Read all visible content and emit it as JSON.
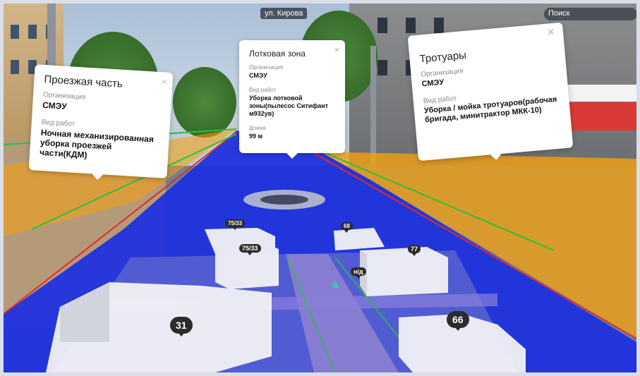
{
  "map": {
    "street_label": "ул. Кирова",
    "search_placeholder": "Поиск"
  },
  "cards": [
    {
      "title": "Проезжая часть",
      "org_label": "Организация",
      "org_value": "СМЭУ",
      "work_label": "Вид работ",
      "work_value": "Ночная механизированная уборка проезжей части(КДМ)"
    },
    {
      "title": "Лотковая зона",
      "org_label": "Организация",
      "org_value": "СМЭУ",
      "work_label": "Вид работ",
      "work_value": "Уборка лотковой зоны(пылесос Ситифант м932ув)",
      "length_label": "Длина",
      "length_value": "99 м"
    },
    {
      "title": "Тротуары",
      "org_label": "Организация",
      "org_value": "СМЭУ",
      "work_label": "Вид работ",
      "work_value": "Уборка / мойка тротуаров(рабочая бригада, минитрактор МКК-10)"
    }
  ],
  "building_labels": [
    "75/33",
    "75/33",
    "68",
    "77",
    "н/д",
    "31",
    "66"
  ],
  "colors": {
    "roadway": "#1c2fe0",
    "sidewalk": "#f6a10e",
    "gutter_line": "#27c23a",
    "curb_line": "#e02a2a"
  },
  "close_icon": "×"
}
